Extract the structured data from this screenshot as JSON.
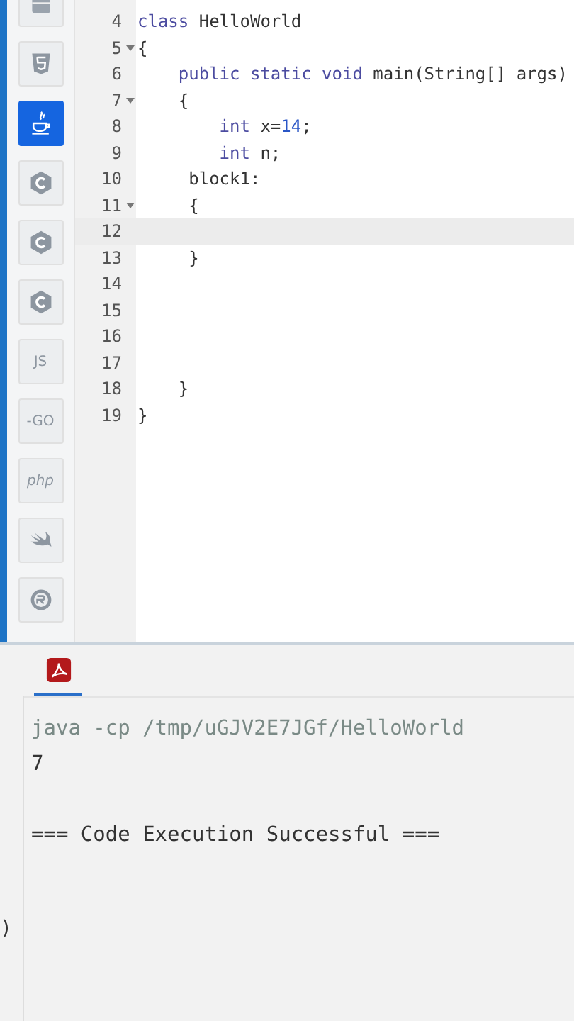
{
  "sidebar": {
    "items": [
      {
        "kind": "database",
        "selected": false
      },
      {
        "kind": "html",
        "selected": false
      },
      {
        "kind": "java",
        "selected": true
      },
      {
        "kind": "c",
        "selected": false
      },
      {
        "kind": "c",
        "selected": false
      },
      {
        "kind": "c",
        "selected": false
      },
      {
        "kind": "text",
        "label": "JS",
        "selected": false
      },
      {
        "kind": "text",
        "label": "-GO",
        "selected": false
      },
      {
        "kind": "italic",
        "label": "php",
        "selected": false
      },
      {
        "kind": "swift",
        "selected": false
      },
      {
        "kind": "rust",
        "selected": false
      }
    ]
  },
  "editor": {
    "lines": [
      {
        "number": "4",
        "foldable": false,
        "highlighted": false,
        "tokens": [
          {
            "kind": "keyword",
            "text": "class"
          },
          {
            "kind": "plain",
            "text": " HelloWorld"
          }
        ]
      },
      {
        "number": "5",
        "foldable": true,
        "highlighted": false,
        "tokens": [
          {
            "kind": "plain",
            "text": "{"
          }
        ]
      },
      {
        "number": "6",
        "foldable": false,
        "highlighted": false,
        "tokens": [
          {
            "kind": "keyword",
            "text": "    public static void"
          },
          {
            "kind": "plain",
            "text": " main(String[] args)"
          }
        ]
      },
      {
        "number": "7",
        "foldable": true,
        "highlighted": false,
        "tokens": [
          {
            "kind": "plain",
            "text": "    {"
          }
        ]
      },
      {
        "number": "8",
        "foldable": false,
        "highlighted": false,
        "tokens": [
          {
            "kind": "keyword",
            "text": "        int"
          },
          {
            "kind": "plain",
            "text": " x="
          },
          {
            "kind": "number",
            "text": "14"
          },
          {
            "kind": "plain",
            "text": ";"
          }
        ]
      },
      {
        "number": "9",
        "foldable": false,
        "highlighted": false,
        "tokens": [
          {
            "kind": "keyword",
            "text": "        int"
          },
          {
            "kind": "plain",
            "text": " n;"
          }
        ]
      },
      {
        "number": "10",
        "foldable": false,
        "highlighted": false,
        "tokens": [
          {
            "kind": "plain",
            "text": "     block1:"
          }
        ]
      },
      {
        "number": "11",
        "foldable": true,
        "highlighted": false,
        "tokens": [
          {
            "kind": "plain",
            "text": "     {"
          }
        ]
      },
      {
        "number": "12",
        "foldable": false,
        "highlighted": true
      },
      {
        "number": "13",
        "foldable": false,
        "highlighted": false,
        "tokens": [
          {
            "kind": "plain",
            "text": "     }"
          }
        ]
      },
      {
        "number": "14",
        "foldable": false,
        "highlighted": false
      },
      {
        "number": "15",
        "foldable": false,
        "highlighted": false
      },
      {
        "number": "16",
        "foldable": false,
        "highlighted": false
      },
      {
        "number": "17",
        "foldable": false,
        "highlighted": false
      },
      {
        "number": "18",
        "foldable": false,
        "highlighted": false,
        "tokens": [
          {
            "kind": "plain",
            "text": "    }"
          }
        ]
      },
      {
        "number": "19",
        "foldable": false,
        "highlighted": false,
        "tokens": [
          {
            "kind": "plain",
            "text": "}"
          }
        ]
      }
    ]
  },
  "bottom_panel": {
    "tabs": [
      {
        "kind": "pdf",
        "selected": true
      }
    ],
    "code_fragment": ")",
    "output": [
      {
        "kind": "command",
        "text": "java -cp /tmp/uGJV2E7JGf/HelloWorld"
      },
      {
        "kind": "result",
        "text": "7"
      },
      {
        "kind": "blank"
      },
      {
        "kind": "result",
        "text": "=== Code Execution Successful ==="
      }
    ]
  }
}
